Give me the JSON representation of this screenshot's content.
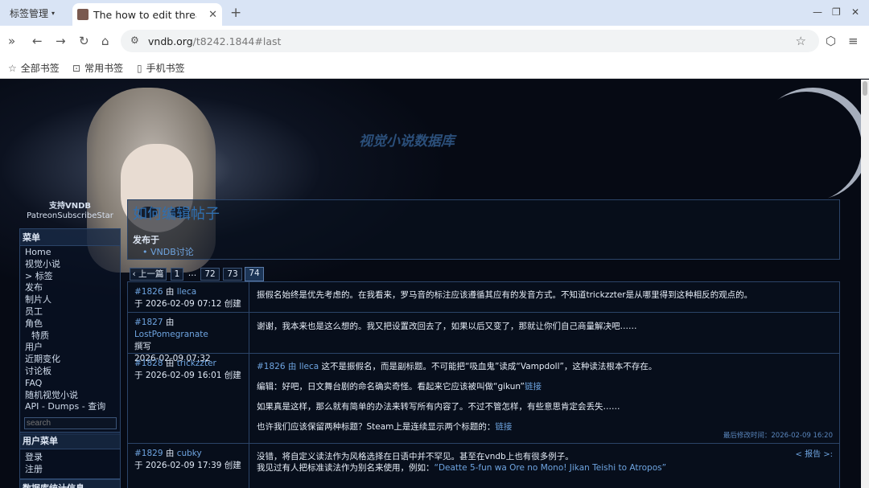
{
  "browser": {
    "tab_group": "标签管理",
    "tab_title": "The how to edit thread",
    "url_host": "vndb.org",
    "url_path": "/t8242.1844#last",
    "bookmarks": [
      "全部书签",
      "常用书签",
      "手机书签"
    ]
  },
  "site": {
    "title": "视觉小说数据库",
    "support_title": "支持VNDB",
    "support_links": "PatreonSubscribeStar"
  },
  "menu": {
    "title": "菜单",
    "items": [
      "Home",
      "视觉小说",
      "> 标签",
      "发布",
      "制片人",
      "员工",
      "角色",
      "特质",
      "用户",
      "近期变化",
      "讨论板",
      "FAQ",
      "随机视觉小说",
      "API - Dumps - 查询"
    ],
    "search_placeholder": "search"
  },
  "user_menu": {
    "title": "用户菜单",
    "items": [
      "登录",
      "注册"
    ]
  },
  "stats_menu": {
    "title": "数据库统计信息"
  },
  "thread": {
    "title": "如何编辑帖子",
    "posted_in_label": "发布于",
    "board": "VNDB讨论"
  },
  "pager": {
    "prev": "‹ 上一篇",
    "pages": [
      "1",
      "…",
      "72",
      "73",
      "74"
    ],
    "current": "74"
  },
  "posts": [
    {
      "num": "#1826",
      "by": "由",
      "user": "lleca",
      "date": "于 2026-02-09 07:12 创建",
      "paragraphs": [
        "振假名始终是优先考虑的。在我看来，罗马音的标注应该遵循其应有的发音方式。不知道trickzzter是从哪里得到这种相反的观点的。"
      ]
    },
    {
      "num": "#1827",
      "by": "由",
      "user": "LostPomegranate",
      "role": "撰写",
      "date": "2026-02-09 07:32",
      "paragraphs": [
        "谢谢，我本来也是这么想的。我又把设置改回去了，如果以后又变了，那就让你们自己商量解决吧……"
      ]
    },
    {
      "num": "#1828",
      "by": "由",
      "user": "trickzzter",
      "date": "于 2026-02-09 16:01 创建",
      "quote_ref": "#1826 由 lleca",
      "p1": "这不是振假名，而是副标题。不可能把“吸血鬼”读成“Vampdoll”，这种读法根本不存在。",
      "p2": "编辑：好吧，日文舞台剧的命名确实奇怪。看起来它应该被叫做“gikun”",
      "p2_link": "链接",
      "p3": "如果真是这样，那么就有简单的办法来转写所有内容了。不过不管怎样，有些意思肯定会丢失……",
      "p4": "也许我们应该保留两种标题？Steam上是连续显示两个标题的：",
      "p4_link": "链接",
      "edited": "最后修改时间：2026-02-09 16:20"
    },
    {
      "num": "#1829",
      "by": "由",
      "user": "cubky",
      "date": "于 2026-02-09 17:39 创建",
      "p1": "没错，将自定义读法作为风格选择在日语中并不罕见。甚至在vndb上也有很多例子。",
      "p2": "我见过有人把标准读法作为别名来使用，例如：",
      "p2_link": "“Deatte 5-fun wa Ore no Mono! Jikan Teishi to Atropos”",
      "report": "< 报告 >:"
    }
  ]
}
